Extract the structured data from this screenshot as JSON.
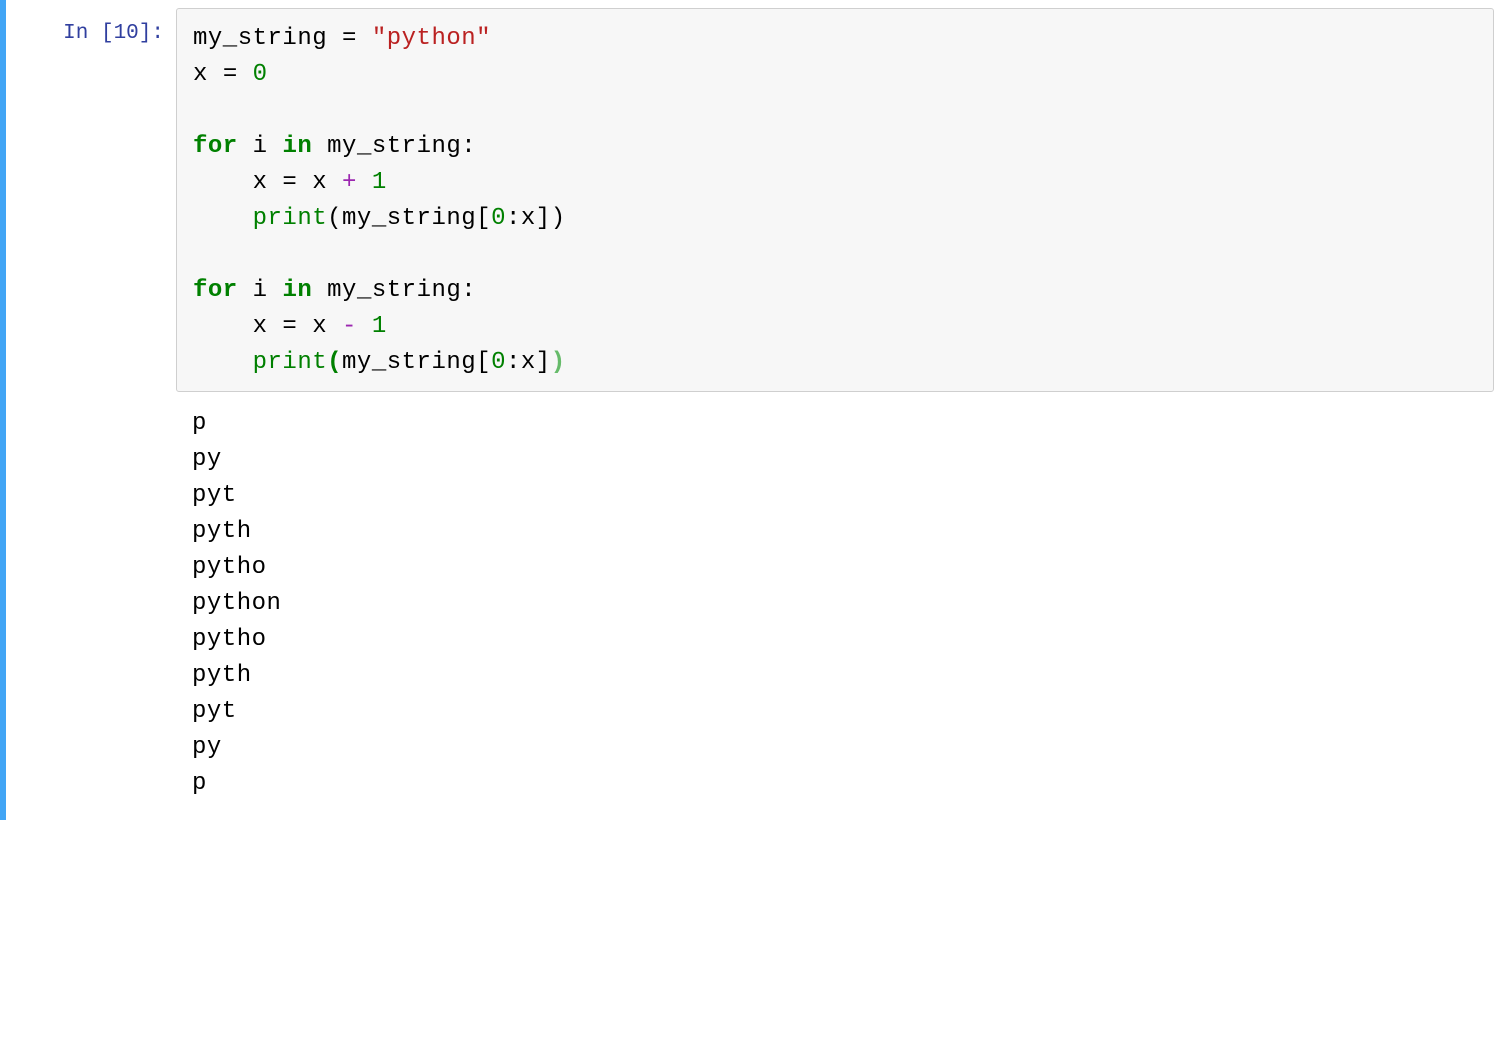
{
  "cell": {
    "prompt": "In [10]:",
    "code": {
      "l1": {
        "a": "my_string ",
        "eq": "=",
        "sp": " ",
        "str": "\"python\""
      },
      "l2": {
        "a": "x ",
        "eq": "=",
        "sp": " ",
        "num": "0"
      },
      "l3": "",
      "l4": {
        "kw1": "for",
        "sp1": " ",
        "var": "i",
        "sp2": " ",
        "kw2": "in",
        "sp3": " ",
        "name": "my_string",
        "colon": ":"
      },
      "l5": {
        "indent": "    ",
        "a": "x ",
        "eq": "=",
        "sp1": " ",
        "b": "x ",
        "op": "+",
        "sp2": " ",
        "num": "1"
      },
      "l6": {
        "indent": "    ",
        "fn": "print",
        "lp": "(",
        "name": "my_string",
        "lb": "[",
        "n0": "0",
        "colon": ":",
        "var": "x",
        "rb": "]",
        "rp": ")"
      },
      "l7": {
        "indent": "    "
      },
      "l8": {
        "kw1": "for",
        "sp1": " ",
        "var": "i",
        "sp2": " ",
        "kw2": "in",
        "sp3": " ",
        "name": "my_string",
        "colon": ":"
      },
      "l9": {
        "indent": "    ",
        "a": "x ",
        "eq": "=",
        "sp1": " ",
        "b": "x ",
        "op": "-",
        "sp2": " ",
        "num": "1"
      },
      "l10": {
        "indent": "    ",
        "fn": "print",
        "lp": "(",
        "name": "my_string",
        "lb": "[",
        "n0": "0",
        "colon": ":",
        "var": "x",
        "rb": "]",
        "rp": ")"
      }
    },
    "output": "p\npy\npyt\npyth\npytho\npython\npytho\npyth\npyt\npy\np\n"
  }
}
